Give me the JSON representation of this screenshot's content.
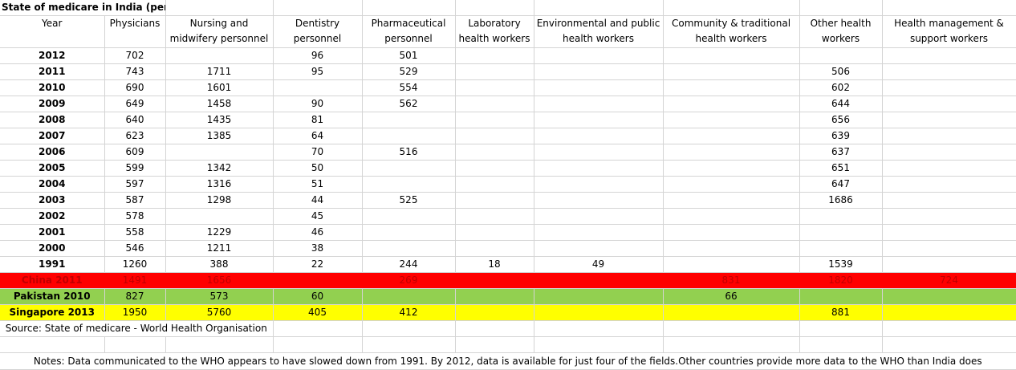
{
  "title": "State of medicare in India  (per million population)",
  "headers": [
    "Year",
    "Physicians",
    "Nursing and midwifery personnel",
    "Dentistry personnel",
    "Pharmaceutical personnel",
    "Laboratory health workers",
    "Environmental and public health workers",
    "Community & traditional health workers",
    "Other health workers",
    "Health management & support workers"
  ],
  "rows": [
    {
      "label": "2012",
      "cells": [
        "702",
        "",
        "96",
        "501",
        "",
        "",
        "",
        "",
        ""
      ]
    },
    {
      "label": "2011",
      "cells": [
        "743",
        "1711",
        "95",
        "529",
        "",
        "",
        "",
        "506",
        ""
      ]
    },
    {
      "label": "2010",
      "cells": [
        "690",
        "1601",
        "",
        "554",
        "",
        "",
        "",
        "602",
        ""
      ]
    },
    {
      "label": "2009",
      "cells": [
        "649",
        "1458",
        "90",
        "562",
        "",
        "",
        "",
        "644",
        ""
      ]
    },
    {
      "label": "2008",
      "cells": [
        "640",
        "1435",
        "81",
        "",
        "",
        "",
        "",
        "656",
        ""
      ]
    },
    {
      "label": "2007",
      "cells": [
        "623",
        "1385",
        "64",
        "",
        "",
        "",
        "",
        "639",
        ""
      ]
    },
    {
      "label": "2006",
      "cells": [
        "609",
        "",
        "70",
        "516",
        "",
        "",
        "",
        "637",
        ""
      ]
    },
    {
      "label": "2005",
      "cells": [
        "599",
        "1342",
        "50",
        "",
        "",
        "",
        "",
        "651",
        ""
      ]
    },
    {
      "label": "2004",
      "cells": [
        "597",
        "1316",
        "51",
        "",
        "",
        "",
        "",
        "647",
        ""
      ]
    },
    {
      "label": "2003",
      "cells": [
        "587",
        "1298",
        "44",
        "525",
        "",
        "",
        "",
        "1686",
        ""
      ]
    },
    {
      "label": "2002",
      "cells": [
        "578",
        "",
        "45",
        "",
        "",
        "",
        "",
        "",
        ""
      ]
    },
    {
      "label": "2001",
      "cells": [
        "558",
        "1229",
        "46",
        "",
        "",
        "",
        "",
        "",
        ""
      ]
    },
    {
      "label": "2000",
      "cells": [
        "546",
        "1211",
        "38",
        "",
        "",
        "",
        "",
        "",
        ""
      ]
    },
    {
      "label": "1991",
      "cells": [
        "1260",
        "388",
        "22",
        "244",
        "18",
        "49",
        "",
        "1539",
        ""
      ]
    }
  ],
  "comparisons": [
    {
      "label": "China 2011",
      "color": "#ff0000",
      "cells": [
        "1491",
        "1656",
        "",
        "269",
        "",
        "",
        "831",
        "1820",
        "724"
      ]
    },
    {
      "label": "Pakistan 2010",
      "color": "#92d050",
      "cells": [
        "827",
        "573",
        "60",
        "",
        "",
        "",
        "66",
        "",
        ""
      ]
    },
    {
      "label": "Singapore 2013",
      "color": "#ffff00",
      "cells": [
        "1950",
        "5760",
        "405",
        "412",
        "",
        "",
        "",
        "881",
        ""
      ]
    }
  ],
  "source": "Source: State of medicare - World Health Organisation",
  "notes": "Notes: Data communicated to the WHO appears to have slowed down from 1991. By 2012, data is available for just four of the fields.Other countries provide more data to the WHO than India does"
}
